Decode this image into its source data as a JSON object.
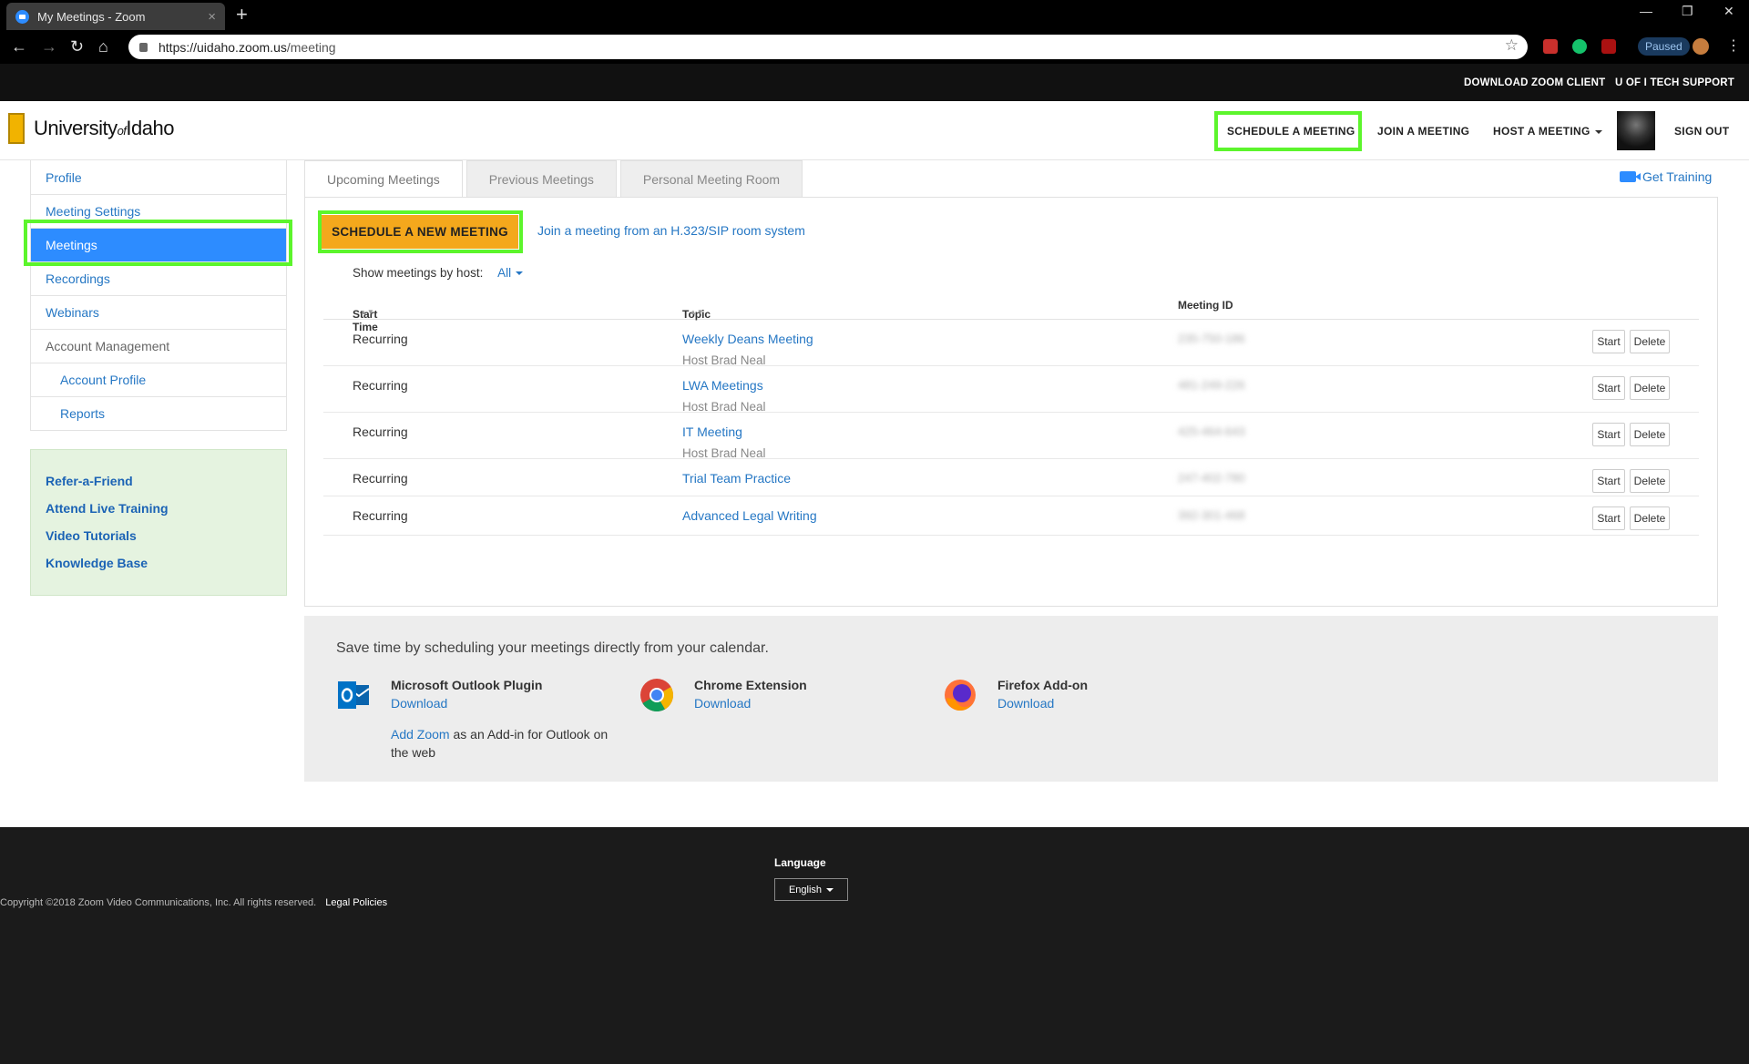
{
  "browser": {
    "tab_title": "My Meetings - Zoom",
    "url_host": "https://uidaho.zoom.us",
    "url_path": "/meeting",
    "paused_label": "Paused"
  },
  "topbar": {
    "download_client": "DOWNLOAD ZOOM CLIENT",
    "tech_support": "U OF I TECH SUPPORT"
  },
  "header": {
    "logo_part1": "University",
    "logo_of": "of",
    "logo_part2": "Idaho",
    "schedule": "SCHEDULE A MEETING",
    "join": "JOIN A MEETING",
    "host": "HOST A MEETING",
    "signout": "SIGN OUT"
  },
  "sidebar": {
    "items": [
      {
        "label": "Profile"
      },
      {
        "label": "Meeting Settings"
      },
      {
        "label": "Meetings"
      },
      {
        "label": "Recordings"
      },
      {
        "label": "Webinars"
      },
      {
        "label": "Account Management"
      },
      {
        "label": "Account Profile"
      },
      {
        "label": "Reports"
      }
    ],
    "promo": [
      "Refer-a-Friend",
      "Attend Live Training",
      "Video Tutorials",
      "Knowledge Base"
    ]
  },
  "tabs": [
    "Upcoming Meetings",
    "Previous Meetings",
    "Personal Meeting Room"
  ],
  "get_training": "Get Training",
  "panel": {
    "schedule_new": "SCHEDULE A NEW MEETING",
    "join_sip": "Join a meeting from an H.323/SIP room system",
    "show_by_host": "Show meetings by host:",
    "host_filter": "All",
    "columns": {
      "start": "Start Time",
      "topic": "Topic",
      "id": "Meeting ID"
    },
    "start_label": "Start",
    "delete_label": "Delete",
    "rows": [
      {
        "start": "Recurring",
        "topic": "Weekly Deans Meeting",
        "host": "Host Brad Neal",
        "id": "235-750-186"
      },
      {
        "start": "Recurring",
        "topic": "LWA Meetings",
        "host": "Host Brad Neal",
        "id": "481-249-226"
      },
      {
        "start": "Recurring",
        "topic": "IT Meeting",
        "host": "Host Brad Neal",
        "id": "425-464-643"
      },
      {
        "start": "Recurring",
        "topic": "Trial Team Practice",
        "host": "",
        "id": "247-402-780"
      },
      {
        "start": "Recurring",
        "topic": "Advanced Legal Writing",
        "host": "",
        "id": "392-301-468"
      }
    ]
  },
  "calendar": {
    "heading": "Save time by scheduling your meetings directly from your calendar.",
    "outlook": {
      "name": "Microsoft Outlook Plugin",
      "download": "Download"
    },
    "chrome": {
      "name": "Chrome Extension",
      "download": "Download"
    },
    "firefox": {
      "name": "Firefox Add-on",
      "download": "Download"
    },
    "addin_link": "Add Zoom",
    "addin_text": " as an Add-in for Outlook on the web"
  },
  "footer": {
    "language_label": "Language",
    "language_value": "English",
    "copyright": "Copyright ©2018 Zoom Video Communications, Inc. All rights reserved.",
    "legal": "Legal Policies"
  },
  "colors": {
    "accent": "#2d8cff",
    "highlight": "#5cf52c",
    "schedule_button": "#f4a81c"
  }
}
